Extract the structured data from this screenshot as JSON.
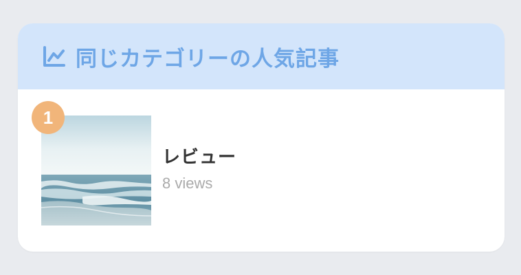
{
  "widget": {
    "title": "同じカテゴリーの人気記事",
    "icon": "line-chart-icon",
    "colors": {
      "header_bg": "#d3e5fb",
      "header_text": "#6ea6e6",
      "badge": "#f1b57a"
    }
  },
  "items": [
    {
      "rank": "1",
      "title": "レビュー",
      "views": "8 views",
      "thumbnail": "ocean-waves-image"
    }
  ]
}
